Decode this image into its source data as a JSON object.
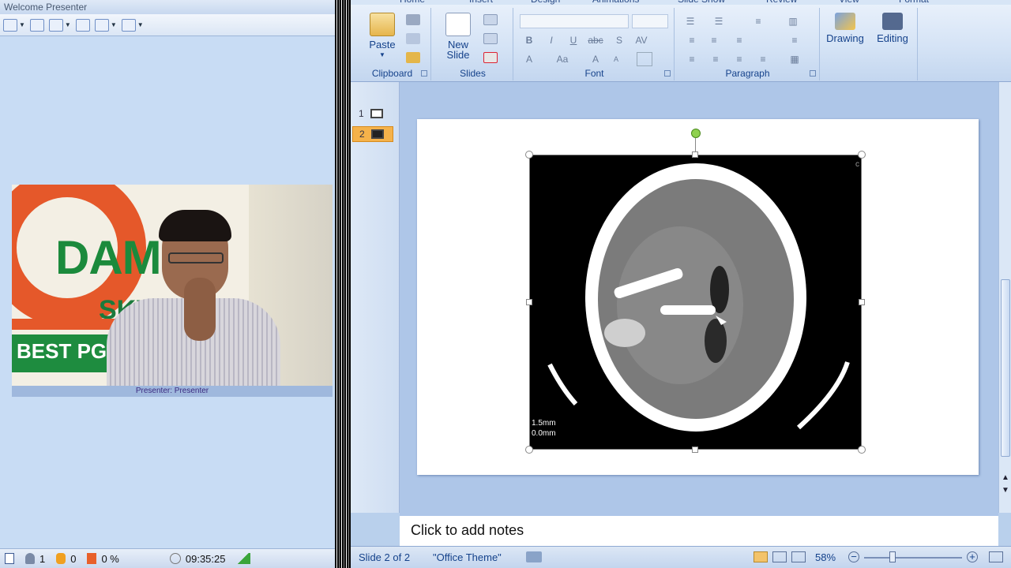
{
  "presenter": {
    "window_title": "Welcome Presenter",
    "caption": "Presenter: Presenter",
    "status": {
      "participants": "1",
      "hands": "0",
      "progress": "0 %",
      "clock": "09:35:25"
    }
  },
  "ribbon": {
    "tabs": [
      "Home",
      "Insert",
      "Design",
      "Animations",
      "Slide Show",
      "Review",
      "View",
      "Format"
    ],
    "groups": {
      "clipboard": {
        "label": "Clipboard",
        "paste": "Paste"
      },
      "slides": {
        "label": "Slides",
        "new_slide_1": "New",
        "new_slide_2": "Slide"
      },
      "font": {
        "label": "Font"
      },
      "paragraph": {
        "label": "Paragraph"
      },
      "drawing": {
        "label": "Drawing"
      },
      "editing": {
        "label": "Editing"
      }
    }
  },
  "thumbnails": {
    "items": [
      "1",
      "2"
    ]
  },
  "slide": {
    "image_text_1": "1.5mm",
    "image_text_2": "0.0mm",
    "corner_char": "c"
  },
  "notes": {
    "placeholder": "Click to add notes"
  },
  "status": {
    "slide_info": "Slide 2 of 2",
    "theme": "\"Office Theme\"",
    "zoom": "58%"
  },
  "colors": {
    "ribbon_text": "#15428b",
    "thumb_selected": "#f5b24a",
    "rotate_handle": "#8fd14f"
  }
}
